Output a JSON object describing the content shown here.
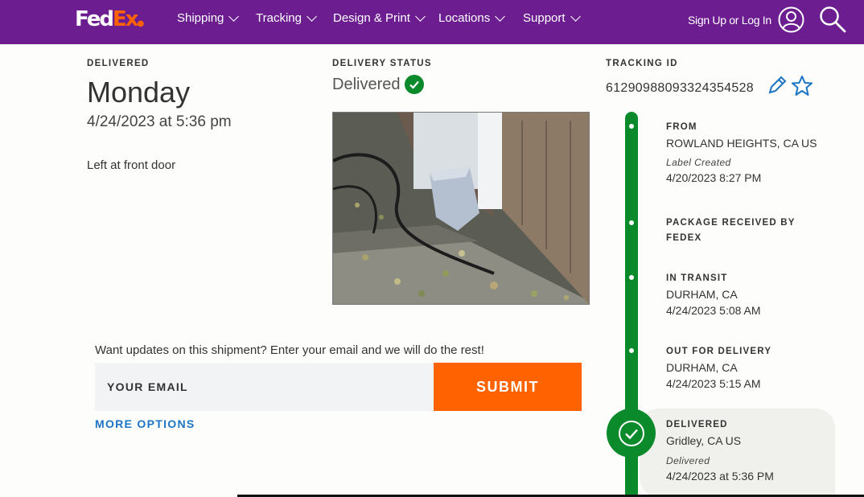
{
  "nav": {
    "logo_fed": "Fed",
    "logo_ex": "Ex",
    "items": [
      {
        "label": "Shipping"
      },
      {
        "label": "Tracking"
      },
      {
        "label": "Design & Print"
      },
      {
        "label": "Locations"
      },
      {
        "label": "Support"
      }
    ],
    "signin_label": "Sign Up or Log In",
    "icons": {
      "user": "user-circle-icon",
      "search": "search-icon"
    }
  },
  "delivered": {
    "label": "DELIVERED",
    "day": "Monday",
    "datetime": "4/24/2023 at 5:36 pm",
    "note": "Left at front door"
  },
  "delivery_status": {
    "label": "DELIVERY STATUS",
    "value": "Delivered"
  },
  "tracking": {
    "label": "TRACKING ID",
    "id": "61290988093324354528",
    "icons": {
      "edit": "pencil-icon",
      "favorite": "star-icon"
    }
  },
  "email_section": {
    "prompt": "Want updates on this shipment? Enter your email and we will do the rest!",
    "placeholder": "YOUR EMAIL",
    "submit_label": "SUBMIT",
    "more_options": "MORE OPTIONS"
  },
  "timeline": [
    {
      "title": "FROM",
      "location": "ROWLAND HEIGHTS, CA US",
      "event": "Label Created",
      "time": "4/20/2023 8:27 PM"
    },
    {
      "title": "PACKAGE RECEIVED BY",
      "title2": "FEDEX"
    },
    {
      "title": "IN TRANSIT",
      "location": "DURHAM, CA",
      "time": "4/24/2023 5:08 AM"
    },
    {
      "title": "OUT FOR DELIVERY",
      "location": "DURHAM, CA",
      "time": "4/24/2023 5:15 AM"
    },
    {
      "title": "DELIVERED",
      "location": "Gridley, CA US",
      "event": "Delivered",
      "time": "4/24/2023 at 5:36 PM"
    }
  ],
  "colors": {
    "nav_bg": "#6c1d8f",
    "accent_orange": "#ff6200",
    "success_green": "#0a8a2a",
    "link_blue": "#1b74c4"
  }
}
